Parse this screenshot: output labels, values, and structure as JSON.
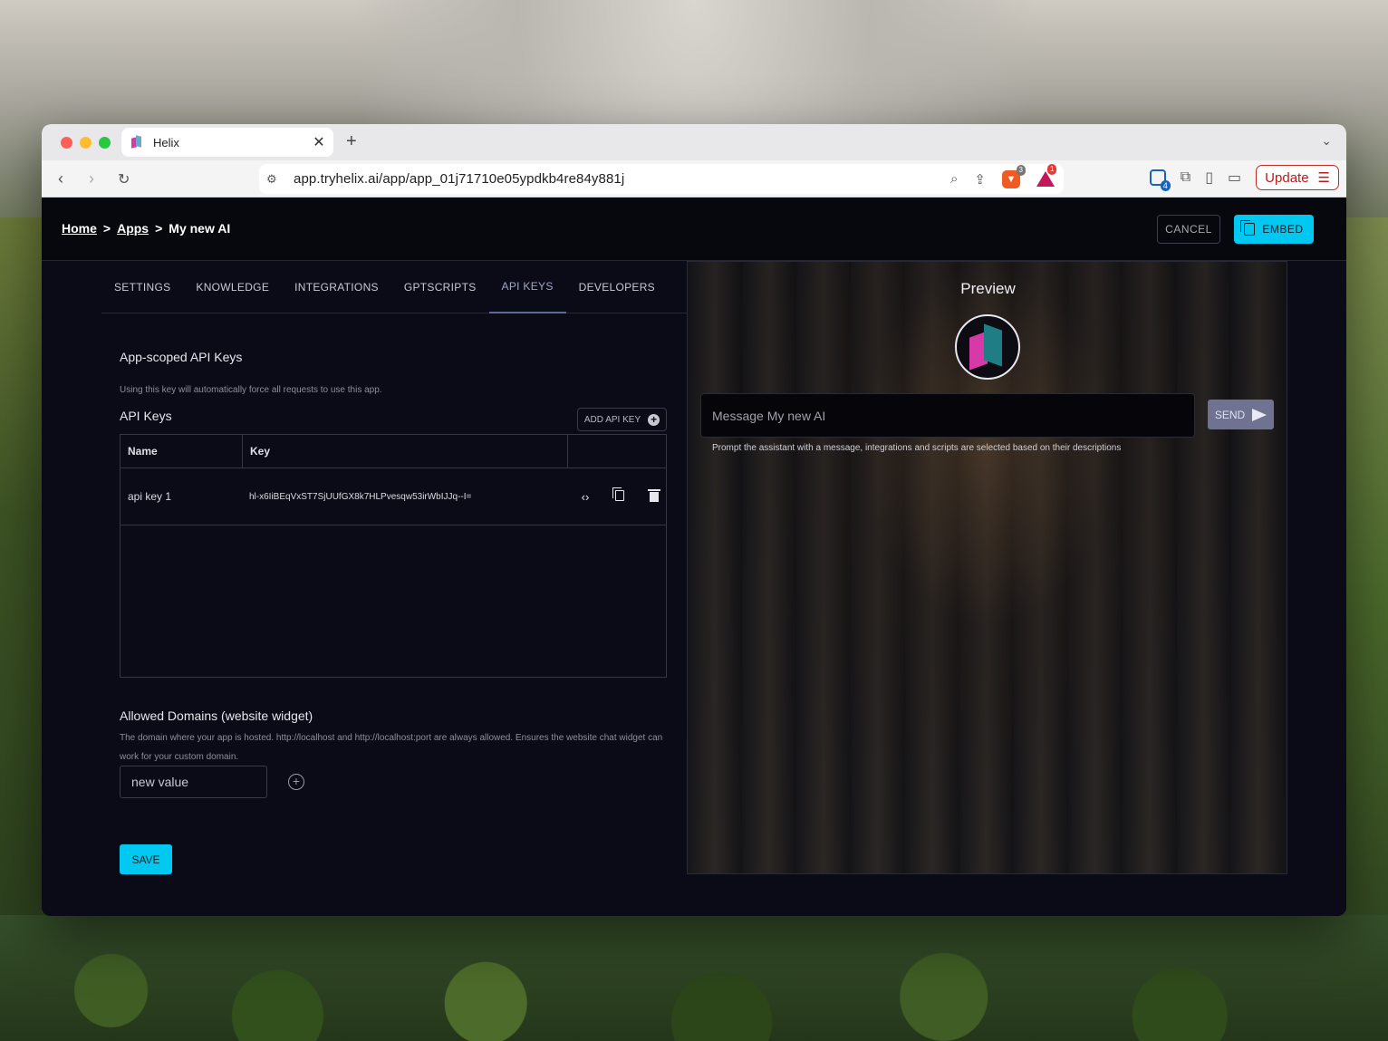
{
  "browser": {
    "tab_title": "Helix",
    "tab_close": "✕",
    "new_tab": "+",
    "url": "app.tryhelix.ai/app/app_01j71710e05ypdkb4re84y881j",
    "brave_count": "3",
    "rewards_count": "1",
    "extension_count": "4",
    "update_label": "Update"
  },
  "app": {
    "breadcrumb": {
      "home": "Home",
      "separator": ">",
      "apps": "Apps",
      "current": "My new AI"
    },
    "cancel_label": "CANCEL",
    "embed_label": "EMBED"
  },
  "tabs": [
    {
      "label": "SETTINGS"
    },
    {
      "label": "KNOWLEDGE"
    },
    {
      "label": "INTEGRATIONS"
    },
    {
      "label": "GPTSCRIPTS"
    },
    {
      "label": "API KEYS"
    },
    {
      "label": "DEVELOPERS"
    }
  ],
  "api_keys": {
    "section_title": "App-scoped API Keys",
    "description": "Using this key will automatically force all requests to use this app.",
    "list_title": "API Keys",
    "add_label": "ADD API KEY",
    "columns": [
      "Name",
      "Key"
    ],
    "rows": [
      {
        "name": "api key 1",
        "key": "hl-x6IiBEqVxST7SjUUfGX8k7HLPvesqw53irWbIJJq--I="
      }
    ]
  },
  "domains": {
    "title": "Allowed Domains (website widget)",
    "description": "The domain where your app is hosted. http://localhost and http://localhost:port are always allowed. Ensures the website chat widget can work for your custom domain.",
    "input_value": "new value"
  },
  "save_label": "SAVE",
  "preview": {
    "title": "Preview",
    "placeholder": "Message My new AI",
    "send_label": "SEND",
    "hint": "Prompt the assistant with a message, integrations and scripts are selected based on their descriptions"
  },
  "colors": {
    "accent": "#00c8f0",
    "background": "#0b0b17",
    "send_button": "#6f7391"
  }
}
